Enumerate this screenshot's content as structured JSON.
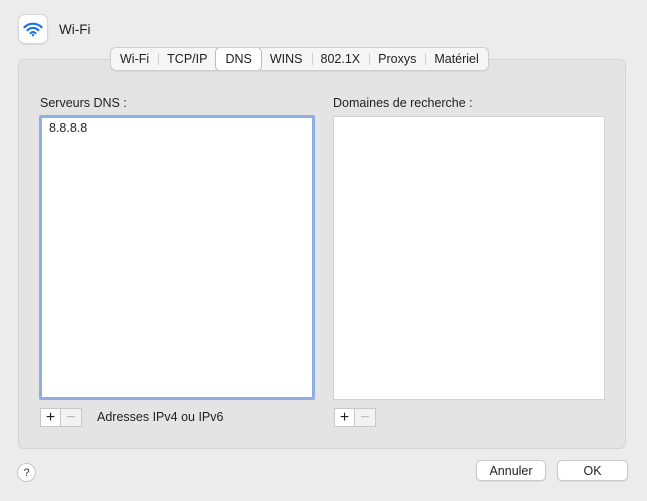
{
  "header": {
    "title": "Wi-Fi",
    "icon": "wifi-icon"
  },
  "tabs": [
    {
      "label": "Wi-Fi",
      "active": false
    },
    {
      "label": "TCP/IP",
      "active": false
    },
    {
      "label": "DNS",
      "active": true
    },
    {
      "label": "WINS",
      "active": false
    },
    {
      "label": "802.1X",
      "active": false
    },
    {
      "label": "Proxys",
      "active": false
    },
    {
      "label": "Matériel",
      "active": false
    }
  ],
  "dns": {
    "label": "Serveurs DNS :",
    "servers": [
      "8.8.8.8"
    ],
    "add": "+",
    "remove": "−",
    "hint": "Adresses IPv4 ou IPv6"
  },
  "search": {
    "label": "Domaines de recherche :",
    "add": "+",
    "remove": "−"
  },
  "footer": {
    "help": "?",
    "cancel": "Annuler",
    "ok": "OK"
  },
  "colors": {
    "accent": "#1a73e8",
    "focus_ring": "#8fafe3"
  }
}
